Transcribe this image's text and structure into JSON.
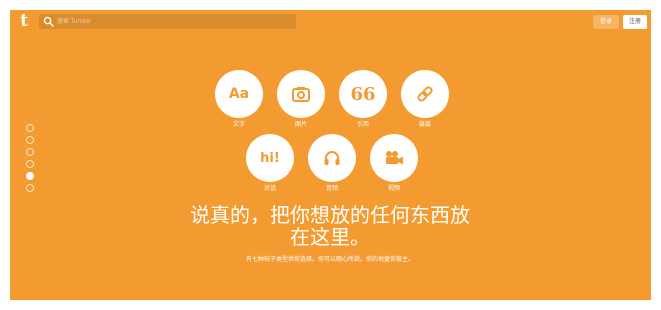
{
  "header": {
    "logo": "t",
    "search": {
      "placeholder": "搜索 Tumblr",
      "value": ""
    },
    "login_label": "登录",
    "register_label": "注册"
  },
  "carousel": {
    "total": 6,
    "active_index": 4
  },
  "post_types": [
    {
      "label": "文字",
      "glyph": "Aa",
      "icon": "text-icon"
    },
    {
      "label": "图片",
      "glyph": "",
      "icon": "camera-icon"
    },
    {
      "label": "引用",
      "glyph": "66",
      "icon": "quote-icon"
    },
    {
      "label": "链接",
      "glyph": "",
      "icon": "link-icon"
    },
    {
      "label": "对话",
      "glyph": "hi!",
      "icon": "chat-icon"
    },
    {
      "label": "音频",
      "glyph": "",
      "icon": "headphones-icon"
    },
    {
      "label": "视频",
      "glyph": "",
      "icon": "video-camera-icon"
    }
  ],
  "headline": {
    "line1": "说真的，把你想放的任何东西放",
    "line2": "在这里。"
  },
  "subtext": "有七种帖子类型供你选择。你可以随心所欲。你的地盘你做主。",
  "colors": {
    "background": "#f39b31",
    "accent": "#f39b31",
    "white": "#ffffff"
  }
}
